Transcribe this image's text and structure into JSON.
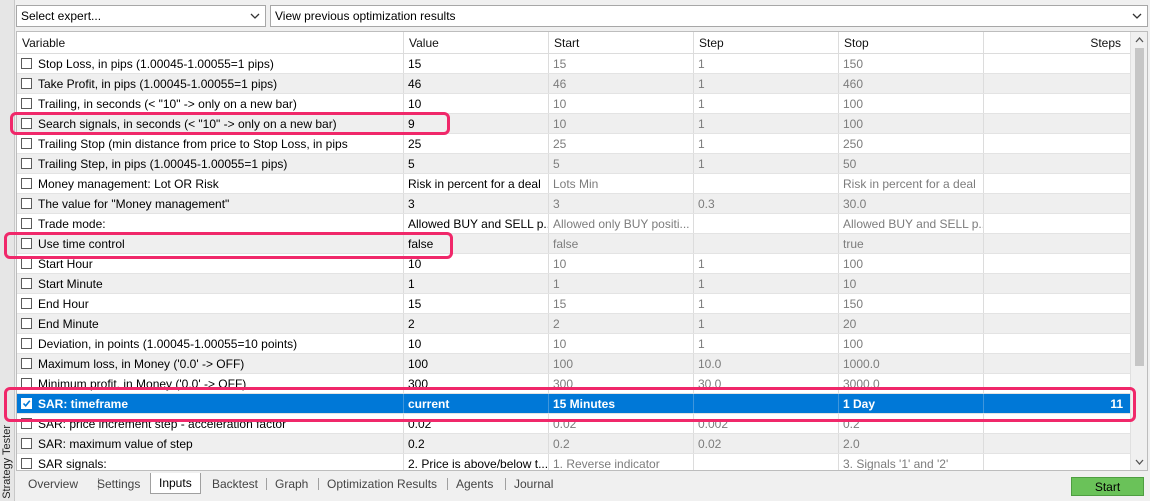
{
  "panel": {
    "side_label": "Strategy Tester"
  },
  "toolbar": {
    "expert_select": "Select expert...",
    "results_select": "View previous optimization results"
  },
  "columns": [
    "Variable",
    "Value",
    "Start",
    "Step",
    "Stop",
    "Steps"
  ],
  "rows": [
    {
      "checked": false,
      "variable": "Stop Loss, in pips (1.00045-1.00055=1 pips)",
      "value": "15",
      "start": "15",
      "step": "1",
      "stop": "150",
      "steps": ""
    },
    {
      "checked": false,
      "variable": "Take Profit, in pips (1.00045-1.00055=1 pips)",
      "value": "46",
      "start": "46",
      "step": "1",
      "stop": "460",
      "steps": ""
    },
    {
      "checked": false,
      "variable": "Trailing, in seconds (< \"10\" -> only on a new bar)",
      "value": "10",
      "start": "10",
      "step": "1",
      "stop": "100",
      "steps": ""
    },
    {
      "checked": false,
      "variable": "Search signals, in seconds (< \"10\" -> only on a new bar)",
      "value": "9",
      "start": "10",
      "step": "1",
      "stop": "100",
      "steps": ""
    },
    {
      "checked": false,
      "variable": "Trailing Stop (min distance from price to Stop Loss, in pips",
      "value": "25",
      "start": "25",
      "step": "1",
      "stop": "250",
      "steps": ""
    },
    {
      "checked": false,
      "variable": "Trailing Step, in pips (1.00045-1.00055=1 pips)",
      "value": "5",
      "start": "5",
      "step": "1",
      "stop": "50",
      "steps": ""
    },
    {
      "checked": false,
      "variable": "Money management: Lot OR Risk",
      "value": "Risk in percent for a deal",
      "start": "Lots Min",
      "step": "",
      "stop": "Risk in percent for a deal",
      "steps": ""
    },
    {
      "checked": false,
      "variable": "The value for \"Money management\"",
      "value": "3",
      "start": "3",
      "step": "0.3",
      "stop": "30.0",
      "steps": ""
    },
    {
      "checked": false,
      "variable": "Trade mode:",
      "value": "Allowed BUY and SELL p...",
      "start": "Allowed only BUY positi...",
      "step": "",
      "stop": "Allowed BUY and SELL p...",
      "steps": ""
    },
    {
      "checked": false,
      "variable": "Use time control",
      "value": "false",
      "start": "false",
      "step": "",
      "stop": "true",
      "steps": ""
    },
    {
      "checked": false,
      "variable": "Start Hour",
      "value": "10",
      "start": "10",
      "step": "1",
      "stop": "100",
      "steps": ""
    },
    {
      "checked": false,
      "variable": "Start Minute",
      "value": "1",
      "start": "1",
      "step": "1",
      "stop": "10",
      "steps": ""
    },
    {
      "checked": false,
      "variable": "End Hour",
      "value": "15",
      "start": "15",
      "step": "1",
      "stop": "150",
      "steps": ""
    },
    {
      "checked": false,
      "variable": "End Minute",
      "value": "2",
      "start": "2",
      "step": "1",
      "stop": "20",
      "steps": ""
    },
    {
      "checked": false,
      "variable": "Deviation, in points (1.00045-1.00055=10 points)",
      "value": "10",
      "start": "10",
      "step": "1",
      "stop": "100",
      "steps": ""
    },
    {
      "checked": false,
      "variable": "Maximum loss, in Money ('0.0' -> OFF)",
      "value": "100",
      "start": "100",
      "step": "10.0",
      "stop": "1000.0",
      "steps": ""
    },
    {
      "checked": false,
      "variable": "Minimum profit, in Money ('0.0' -> OFF)",
      "value": "300",
      "start": "300",
      "step": "30.0",
      "stop": "3000.0",
      "steps": ""
    },
    {
      "checked": true,
      "variable": "SAR: timeframe",
      "value": "current",
      "start": "15 Minutes",
      "step": "",
      "stop": "1 Day",
      "steps": "11"
    },
    {
      "checked": false,
      "variable": "SAR: price increment step - acceleration factor",
      "value": "0.02",
      "start": "0.02",
      "step": "0.002",
      "stop": "0.2",
      "steps": ""
    },
    {
      "checked": false,
      "variable": "SAR: maximum value of step",
      "value": "0.2",
      "start": "0.2",
      "step": "0.02",
      "stop": "2.0",
      "steps": ""
    },
    {
      "checked": false,
      "variable": "SAR signals:",
      "value": "2. Price is above/below t...",
      "start": "1. Reverse indicator",
      "step": "",
      "stop": "3. Signals '1' and '2'",
      "steps": ""
    }
  ],
  "selected_row": 17,
  "highlighted_rows": [
    3,
    9,
    17
  ],
  "tabs": [
    {
      "label": "Overview",
      "active": false
    },
    {
      "label": "Settings",
      "active": false
    },
    {
      "label": "Inputs",
      "active": true
    },
    {
      "label": "Backtest",
      "active": false
    },
    {
      "label": "Graph",
      "active": false
    },
    {
      "label": "Optimization Results",
      "active": false
    },
    {
      "label": "Agents",
      "active": false
    },
    {
      "label": "Journal",
      "active": false
    }
  ],
  "actions": {
    "start_button": "Start"
  },
  "colors": {
    "selection": "#0078d7",
    "highlight_outline": "#f0286a",
    "start_button": "#6ac259",
    "row_alternate": "#efefef"
  }
}
